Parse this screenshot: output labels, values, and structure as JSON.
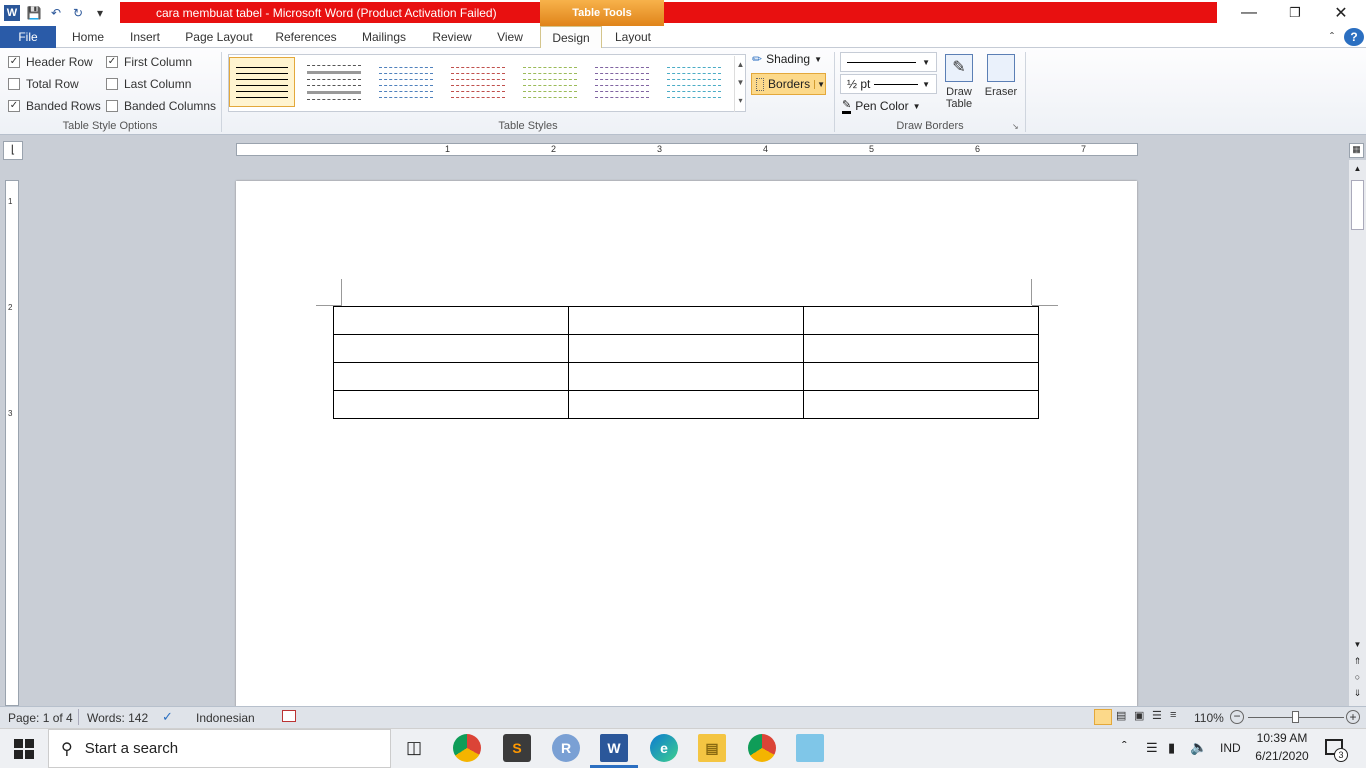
{
  "window": {
    "title": "cara membuat tabel  -  Microsoft Word (Product Activation Failed)",
    "contextual_tab_group": "Table Tools"
  },
  "tabs": [
    "File",
    "Home",
    "Insert",
    "Page Layout",
    "References",
    "Mailings",
    "Review",
    "View",
    "Design",
    "Layout"
  ],
  "table_style_options": {
    "group_label": "Table Style Options",
    "options": [
      {
        "label": "Header Row",
        "checked": true
      },
      {
        "label": "First Column",
        "checked": true
      },
      {
        "label": "Total Row",
        "checked": false
      },
      {
        "label": "Last Column",
        "checked": false
      },
      {
        "label": "Banded Rows",
        "checked": true
      },
      {
        "label": "Banded Columns",
        "checked": false
      }
    ]
  },
  "table_styles": {
    "group_label": "Table Styles",
    "swatch_colors": [
      "#000000",
      "#555555",
      "#4f81bd",
      "#c0504d",
      "#9bbb59",
      "#8064a2",
      "#4bacc6"
    ],
    "shading_label": "Shading",
    "borders_label": "Borders"
  },
  "draw_borders": {
    "group_label": "Draw Borders",
    "weight": "½ pt",
    "pen_color_label": "Pen Color",
    "draw_table_label": "Draw Table",
    "eraser_label": "Eraser"
  },
  "ruler_numbers": [
    "1",
    "2",
    "3",
    "4",
    "5",
    "6",
    "7"
  ],
  "vruler_numbers": [
    "1",
    "2",
    "3"
  ],
  "document": {
    "rows": 4,
    "cols": 3
  },
  "status": {
    "page": "Page: 1 of 4",
    "words": "Words: 142",
    "language": "Indonesian",
    "zoom": "110%"
  },
  "taskbar": {
    "search_placeholder": "Start a search",
    "lang": "IND",
    "time": "10:39 AM",
    "date": "6/21/2020",
    "notif_count": "3"
  }
}
